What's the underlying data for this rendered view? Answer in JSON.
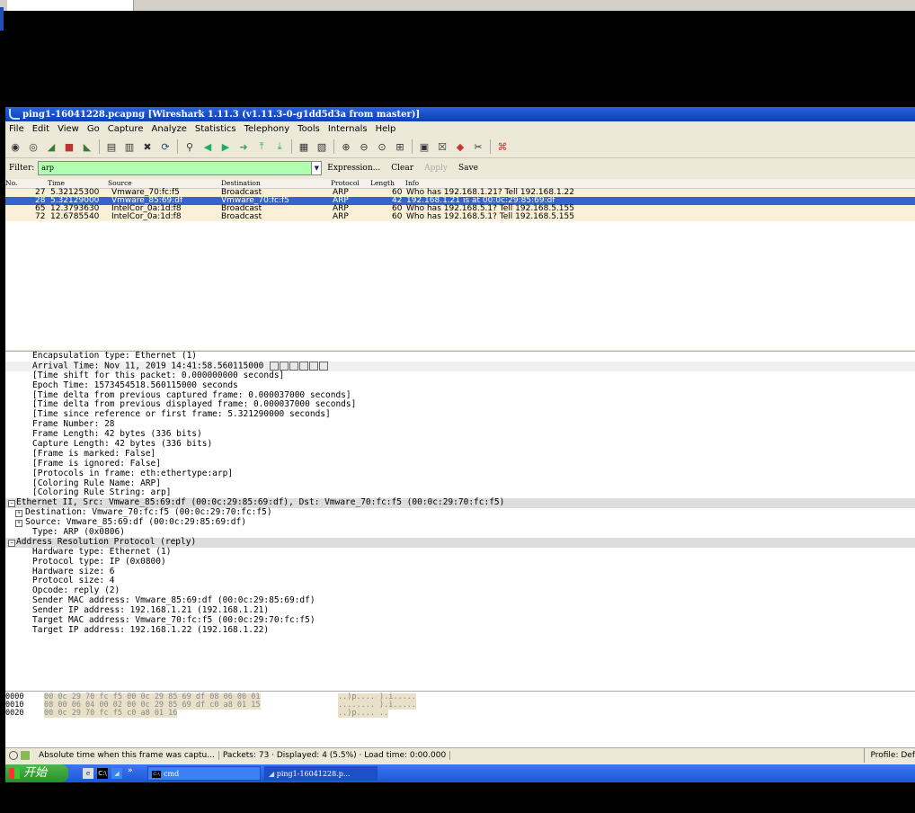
{
  "window": {
    "title": "ping1-16041228.pcapng    [Wireshark 1.11.3  (v1.11.3-0-g1dd5d3a from master)]"
  },
  "menu": [
    "File",
    "Edit",
    "View",
    "Go",
    "Capture",
    "Analyze",
    "Statistics",
    "Telephony",
    "Tools",
    "Internals",
    "Help"
  ],
  "filter": {
    "label": "Filter:",
    "value": "arp",
    "expression": "Expression...",
    "clear": "Clear",
    "apply": "Apply",
    "save": "Save"
  },
  "packet_list": {
    "headers": [
      "No.",
      "Time",
      "Source",
      "Destination",
      "Protocol",
      "Length",
      "Info"
    ],
    "rows": [
      {
        "no": "27",
        "time": "5.32125300",
        "source": "Vmware_70:fc:f5",
        "destination": "Broadcast",
        "protocol": "ARP",
        "length": "60",
        "info": "Who has 192.168.1.21?  Tell 192.168.1.22"
      },
      {
        "no": "28",
        "time": "5.32129000",
        "source": "Vmware_85:69:df",
        "destination": "Vmware_70:fc:f5",
        "protocol": "ARP",
        "length": "42",
        "info": "192.168.1.21 is at 00:0c:29:85:69:df"
      },
      {
        "no": "65",
        "time": "12.3793630",
        "source": "IntelCor_0a:1d:f8",
        "destination": "Broadcast",
        "protocol": "ARP",
        "length": "60",
        "info": "Who has 192.168.5.1?  Tell 192.168.5.155"
      },
      {
        "no": "72",
        "time": "12.6785540",
        "source": "IntelCor_0a:1d:f8",
        "destination": "Broadcast",
        "protocol": "ARP",
        "length": "60",
        "info": "Who has 192.168.5.1?  Tell 192.168.5.155"
      }
    ]
  },
  "details": {
    "frame_lines": [
      "Encapsulation type: Ethernet (1)",
      "Arrival Time: Nov 11, 2019 14:41:58.560115000",
      "[Time shift for this packet: 0.000000000 seconds]",
      "Epoch Time: 1573454518.560115000 seconds",
      "[Time delta from previous captured frame: 0.000037000 seconds]",
      "[Time delta from previous displayed frame: 0.000037000 seconds]",
      "[Time since reference or first frame: 5.321290000 seconds]",
      "Frame Number: 28",
      "Frame Length: 42 bytes (336 bits)",
      "Capture Length: 42 bytes (336 bits)",
      "[Frame is marked: False]",
      "[Frame is ignored: False]",
      "[Protocols in frame: eth:ethertype:arp]",
      "[Coloring Rule Name: ARP]",
      "[Coloring Rule String: arp]"
    ],
    "ethernet_header": "Ethernet II, Src: Vmware_85:69:df (00:0c:29:85:69:df), Dst: Vmware_70:fc:f5 (00:0c:29:70:fc:f5)",
    "ethernet_lines": [
      "Destination: Vmware_70:fc:f5 (00:0c:29:70:fc:f5)",
      "Source: Vmware_85:69:df (00:0c:29:85:69:df)",
      "Type: ARP (0x0806)"
    ],
    "arp_header": "Address Resolution Protocol (reply)",
    "arp_lines": [
      "Hardware type: Ethernet (1)",
      "Protocol type: IP (0x0800)",
      "Hardware size: 6",
      "Protocol size: 4",
      "Opcode: reply (2)",
      "Sender MAC address: Vmware_85:69:df (00:0c:29:85:69:df)",
      "Sender IP address: 192.168.1.21 (192.168.1.21)",
      "Target MAC address: Vmware_70:fc:f5 (00:0c:29:70:fc:f5)",
      "Target IP address: 192.168.1.22 (192.168.1.22)"
    ]
  },
  "hex": {
    "rows": [
      {
        "offset": "0000",
        "bytes": "00 0c 29 70 fc f5 00 0c  29 85 69 df 08 06 00 01",
        "ascii": "..)p.... ).i....."
      },
      {
        "offset": "0010",
        "bytes": "08 00 06 04 00 02 00 0c  29 85 69 df c0 a8 01 15",
        "ascii": "........ ).i....."
      },
      {
        "offset": "0020",
        "bytes": "00 0c 29 70 fc f5 c0 a8  01 16",
        "ascii": "..)p.... .."
      }
    ]
  },
  "status": {
    "message": "Absolute time when this frame was captu...",
    "packets": "Packets: 73 · Displayed: 4 (5.5%) · Load time: 0:00.000",
    "profile": "Profile: Def"
  },
  "taskbar": {
    "start": "开始",
    "quick_more": "»",
    "cmd": "cmd",
    "wireshark": "ping1-16041228.p..."
  },
  "colors": {
    "selected_row": "#3266cc",
    "arp_row": "#faf0d7",
    "filter_ok": "#afffaf",
    "titlebar": "#0a3fb8"
  }
}
